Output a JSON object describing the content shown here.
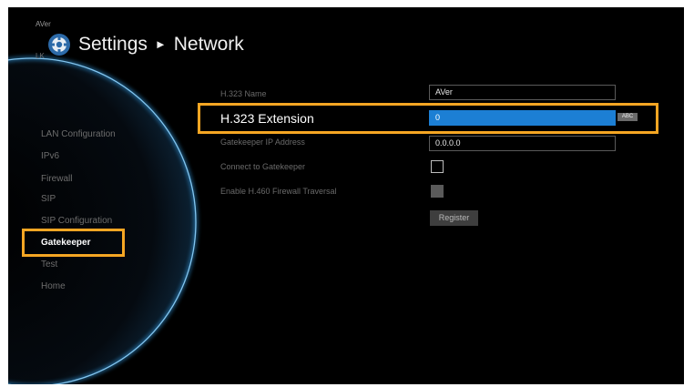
{
  "header": {
    "logo_text": "AVer",
    "logo_sub": "LK",
    "title": "Settings",
    "breadcrumb_arrow": "►",
    "subtitle": "Network"
  },
  "sidebar": {
    "items": [
      {
        "label": "LAN Configuration",
        "active": false
      },
      {
        "label": "IPv6",
        "active": false
      },
      {
        "label": "Firewall",
        "active": false
      },
      {
        "label": "SIP",
        "active": false
      },
      {
        "label": "SIP Configuration",
        "active": false
      },
      {
        "label": "Gatekeeper",
        "active": true
      },
      {
        "label": "Test",
        "active": false
      },
      {
        "label": "Home",
        "active": false
      }
    ]
  },
  "form": {
    "h323_name_label": "H.323 Name",
    "h323_name_value": "AVer",
    "h323_extension_label": "H.323 Extension",
    "h323_extension_value": "0",
    "input_mode_badge": "ABC",
    "gatekeeper_ip_label": "Gatekeeper IP Address",
    "gatekeeper_ip_value": "0.0.0.0",
    "connect_label": "Connect to Gatekeeper",
    "connect_checked": false,
    "h460_label": "Enable H.460 Firewall Traversal",
    "h460_checked": false,
    "h460_enabled": false,
    "register_label": "Register"
  },
  "colors": {
    "highlight": "#f5a623",
    "active_field": "#1c7fd4",
    "background": "#000000",
    "glow": "#3aa8e0"
  }
}
